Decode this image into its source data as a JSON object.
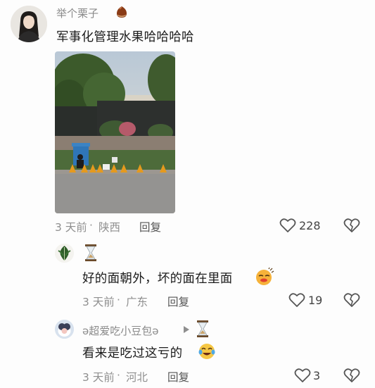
{
  "comments": [
    {
      "username": "举个栗子",
      "text": "军事化管理水果哈哈哈哈",
      "time": "3 天前",
      "location": "陕西",
      "reply_label": "回复",
      "likes": "228"
    },
    {
      "text": "好的面朝外，坏的面在里面",
      "time": "3 天前",
      "location": "广东",
      "reply_label": "回复",
      "likes": "19"
    },
    {
      "username": "ə超爱吃小豆包ə",
      "text": "看来是吃过这亏的",
      "time": "3 天前",
      "location": "河北",
      "reply_label": "回复",
      "likes": "3"
    }
  ],
  "icons": {
    "chestnut": "chestnut-emoji",
    "hourglass": "hourglass-emoji",
    "smirk": "smirk-emoji",
    "laugh_cry": "laugh-cry-emoji",
    "heart": "heart-outline-icon",
    "dislike": "broken-heart-icon",
    "reply_arrow": "reply-arrow-icon"
  },
  "colors": {
    "text": "#1c1c1c",
    "muted": "#8f8f8f",
    "background": "#fdfdfd"
  }
}
